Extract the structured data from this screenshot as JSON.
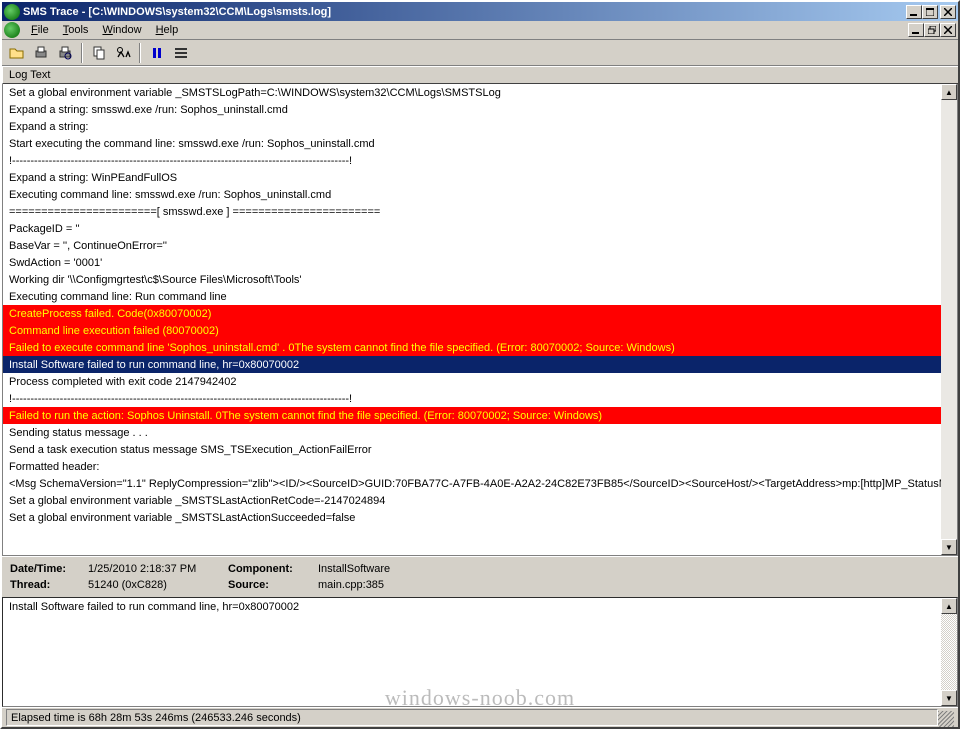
{
  "titlebar": {
    "title": "SMS Trace - [C:\\WINDOWS\\system32\\CCM\\Logs\\smsts.log]"
  },
  "menu": {
    "file": "File",
    "tools": "Tools",
    "window": "Window",
    "help": "Help"
  },
  "column_header": "Log Text",
  "log_lines": [
    {
      "text": "Set a global environment variable _SMSTSLogPath=C:\\WINDOWS\\system32\\CCM\\Logs\\SMSTSLog",
      "cls": ""
    },
    {
      "text": "Expand a string: smsswd.exe /run: Sophos_uninstall.cmd",
      "cls": ""
    },
    {
      "text": "Expand a string:",
      "cls": ""
    },
    {
      "text": "Start executing the command line: smsswd.exe /run: Sophos_uninstall.cmd",
      "cls": ""
    },
    {
      "text": "!--------------------------------------------------------------------------------------------!",
      "cls": ""
    },
    {
      "text": "Expand a string: WinPEandFullOS",
      "cls": ""
    },
    {
      "text": "Executing command line: smsswd.exe /run: Sophos_uninstall.cmd",
      "cls": ""
    },
    {
      "text": "=======================[ smsswd.exe ] =======================",
      "cls": ""
    },
    {
      "text": "PackageID = ''",
      "cls": ""
    },
    {
      "text": "BaseVar = '', ContinueOnError=''",
      "cls": ""
    },
    {
      "text": "SwdAction = '0001'",
      "cls": ""
    },
    {
      "text": "Working dir '\\\\Configmgrtest\\c$\\Source Files\\Microsoft\\Tools'",
      "cls": ""
    },
    {
      "text": "Executing command line: Run command line",
      "cls": ""
    },
    {
      "text": "CreateProcess failed. Code(0x80070002)",
      "cls": "error"
    },
    {
      "text": "Command line execution failed (80070002)",
      "cls": "error"
    },
    {
      "text": "Failed to execute command line 'Sophos_uninstall.cmd' . 0The system cannot find the file specified. (Error: 80070002; Source: Windows)",
      "cls": "error"
    },
    {
      "text": "Install Software failed to run command line, hr=0x80070002",
      "cls": "selected"
    },
    {
      "text": "Process completed with exit code 2147942402",
      "cls": ""
    },
    {
      "text": "!--------------------------------------------------------------------------------------------!",
      "cls": ""
    },
    {
      "text": "Failed to run the action: Sophos Uninstall. 0The system cannot find the file specified. (Error: 80070002; Source: Windows)",
      "cls": "error"
    },
    {
      "text": "Sending status message . . .",
      "cls": ""
    },
    {
      "text": "Send a task execution status message SMS_TSExecution_ActionFailError",
      "cls": ""
    },
    {
      "text": "Formatted header:",
      "cls": ""
    },
    {
      "text": "<Msg SchemaVersion=\"1.1\" ReplyCompression=\"zlib\"><ID/><SourceID>GUID:70FBA77C-A7FB-4A0E-A2A2-24C82E73FB85</SourceID><SourceHost/><TargetAddress>mp:[http]MP_StatusMana",
      "cls": ""
    },
    {
      "text": "Set a global environment variable _SMSTSLastActionRetCode=-2147024894",
      "cls": ""
    },
    {
      "text": "Set a global environment variable _SMSTSLastActionSucceeded=false",
      "cls": ""
    }
  ],
  "details": {
    "datetime_label": "Date/Time:",
    "datetime_value": "1/25/2010 2:18:37 PM",
    "component_label": "Component:",
    "component_value": "InstallSoftware",
    "thread_label": "Thread:",
    "thread_value": "51240 (0xC828)",
    "source_label": "Source:",
    "source_value": "main.cpp:385"
  },
  "message_pane": "Install Software failed to run command line, hr=0x80070002",
  "statusbar": "Elapsed time is 68h 28m 53s 246ms (246533.246 seconds)",
  "watermark": "windows-noob.com"
}
